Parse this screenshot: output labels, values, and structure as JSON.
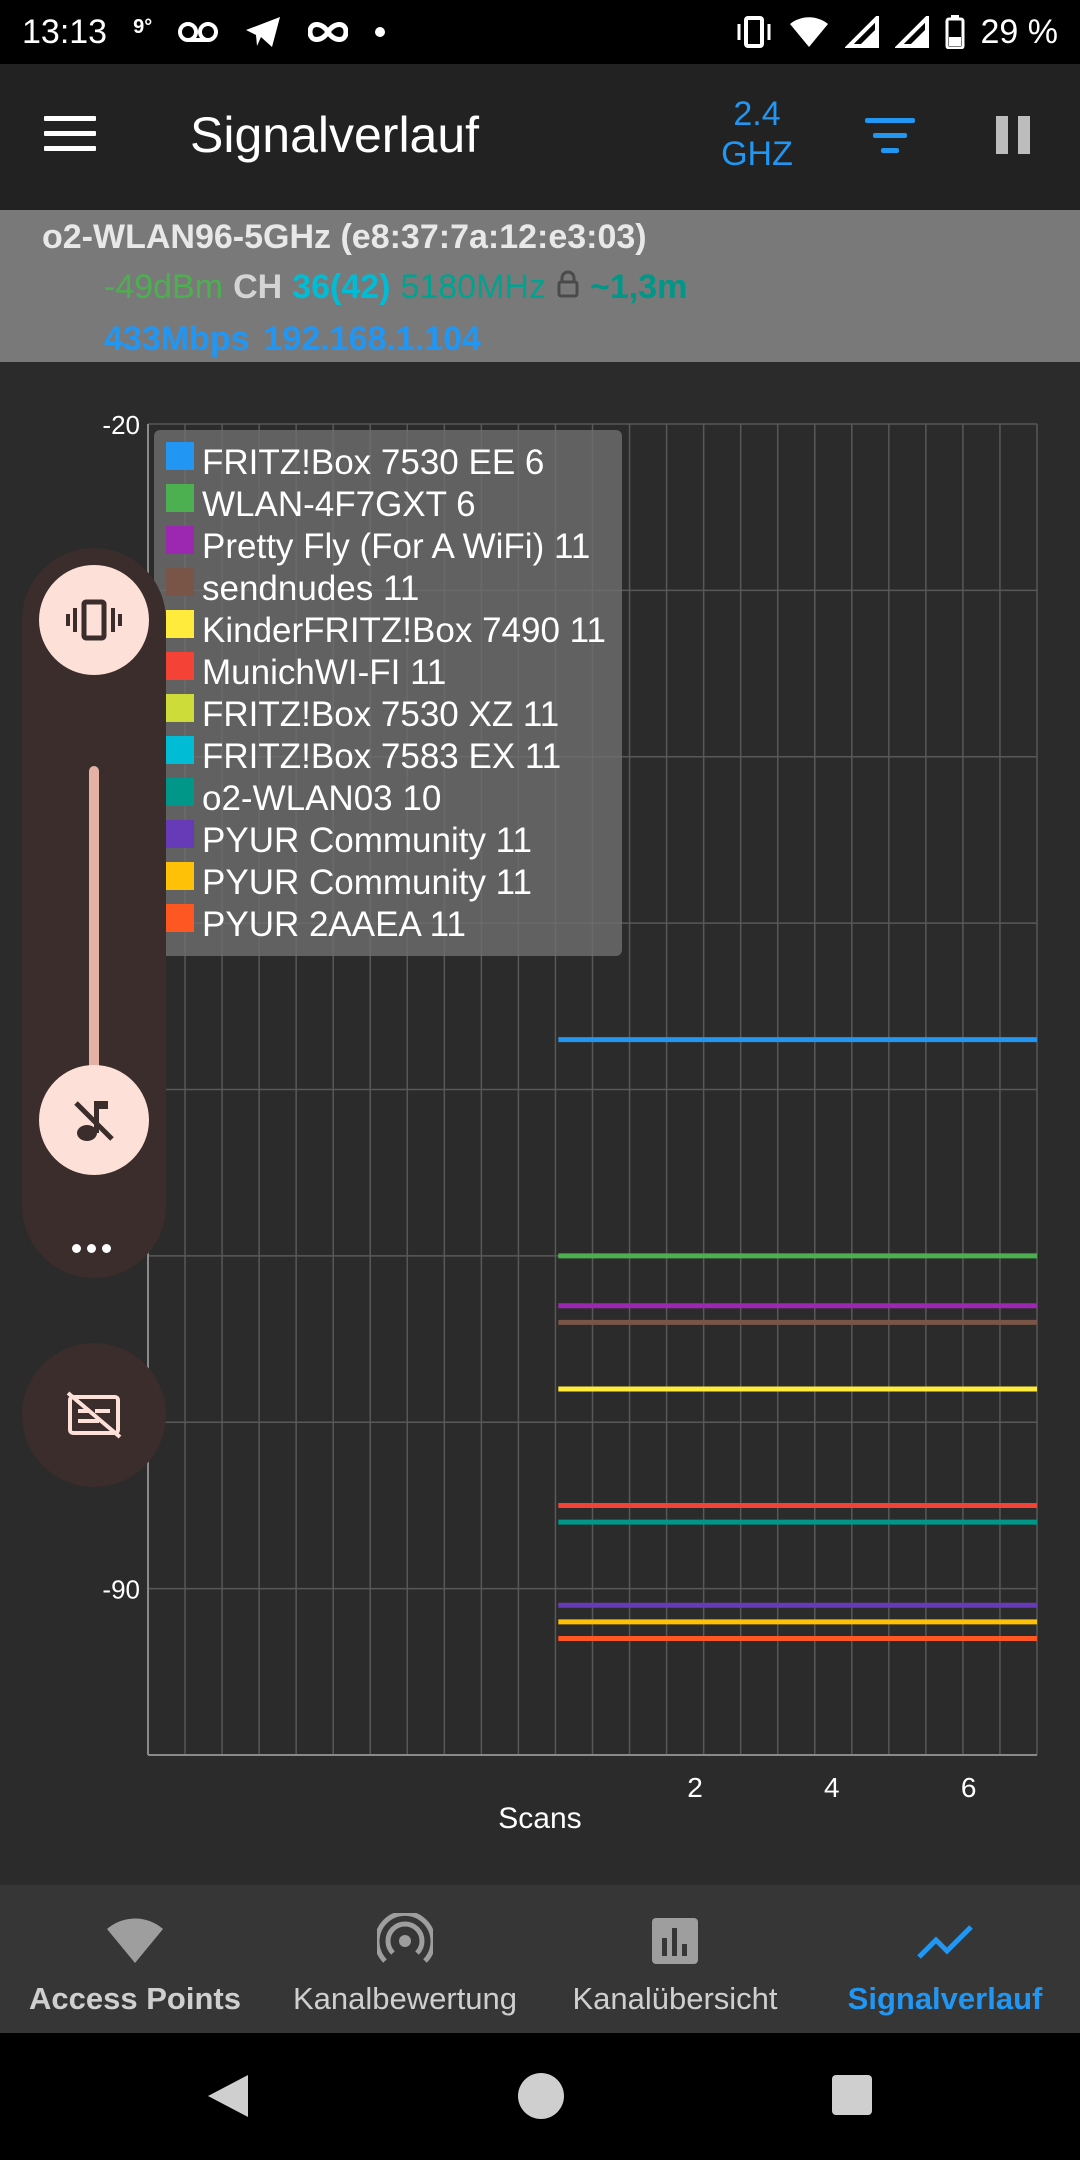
{
  "status_bar": {
    "time": "13:13",
    "temp": "9°",
    "battery": "29 %",
    "icons": [
      "voicemail-icon",
      "telegram-icon",
      "infinity-icon",
      "dot-icon",
      "vibrate-icon",
      "wifi-icon",
      "signal-icon",
      "signal-icon",
      "battery-icon"
    ]
  },
  "app_bar": {
    "title": "Signalverlauf",
    "band_top": "2.4",
    "band_bottom": "GHZ",
    "accent": "#2196f3"
  },
  "connection": {
    "ssid_line": "o2-WLAN96-5GHz (e8:37:7a:12:e3:03)",
    "level": "-49dBm",
    "ch_label": "CH",
    "channel": "36(42)",
    "frequency": "5180MHz",
    "distance": "~1,3m",
    "speed": "433Mbps",
    "ip": "192.168.1.104"
  },
  "chart_data": {
    "type": "line",
    "xlabel": "Scans",
    "y_tick_labels": [
      "-20",
      "-90"
    ],
    "ylim": [
      -100,
      -20
    ],
    "x_tick_labels": [
      "2",
      "4",
      "6"
    ],
    "xlim": [
      -6,
      7
    ],
    "grid": true,
    "legend_placement": "top-left",
    "series": [
      {
        "name": "FRITZ!Box 7530 EE 6",
        "color": "#2196f3",
        "x": [
          0,
          7
        ],
        "values": [
          -57,
          -57
        ]
      },
      {
        "name": "WLAN-4F7GXT 6",
        "color": "#4caf50",
        "x": [
          0,
          7
        ],
        "values": [
          -70,
          -70
        ]
      },
      {
        "name": "Pretty Fly (For A WiFi) 11",
        "color": "#9c27b0",
        "x": [
          0,
          7
        ],
        "values": [
          -73,
          -73
        ]
      },
      {
        "name": "sendnudes 11",
        "color": "#795548",
        "x": [
          0,
          7
        ],
        "values": [
          -74,
          -74
        ]
      },
      {
        "name": "KinderFRITZ!Box 7490 11",
        "color": "#ffeb3b",
        "x": [
          0,
          7
        ],
        "values": [
          -78,
          -78
        ]
      },
      {
        "name": "MunichWI-FI 11",
        "color": "#f44336",
        "x": [
          0,
          7
        ],
        "values": [
          -85,
          -85
        ]
      },
      {
        "name": "FRITZ!Box 7530 XZ 11",
        "color": "#cddc39",
        "x": [
          0,
          7
        ],
        "values": [
          null,
          null
        ]
      },
      {
        "name": "FRITZ!Box 7583 EX 11",
        "color": "#00bcd4",
        "x": [
          0,
          7
        ],
        "values": [
          null,
          null
        ]
      },
      {
        "name": "o2-WLAN03 10",
        "color": "#009688",
        "x": [
          0,
          7
        ],
        "values": [
          -86,
          -86
        ]
      },
      {
        "name": "PYUR Community 11",
        "color": "#673ab7",
        "x": [
          0,
          7
        ],
        "values": [
          -91,
          -91
        ]
      },
      {
        "name": "PYUR Community 11",
        "color": "#ffc107",
        "x": [
          0,
          7
        ],
        "values": [
          -92,
          -92
        ]
      },
      {
        "name": "PYUR 2AAEA 11",
        "color": "#ff5722",
        "x": [
          0,
          7
        ],
        "values": [
          -93,
          -93
        ]
      }
    ]
  },
  "volume_panel": {
    "vibrate_icon": "vibrate-icon",
    "mute_icon": "music-off-icon",
    "more_icon": "more-icon",
    "caption_icon": "captions-off-icon"
  },
  "bottom_nav": [
    {
      "label": "Access Points",
      "icon": "wifi-icon"
    },
    {
      "label": "Kanalbewertung",
      "icon": "radar-icon"
    },
    {
      "label": "Kanalübersicht",
      "icon": "bar-chart-icon"
    },
    {
      "label": "Signalverlauf",
      "icon": "trend-icon"
    }
  ]
}
